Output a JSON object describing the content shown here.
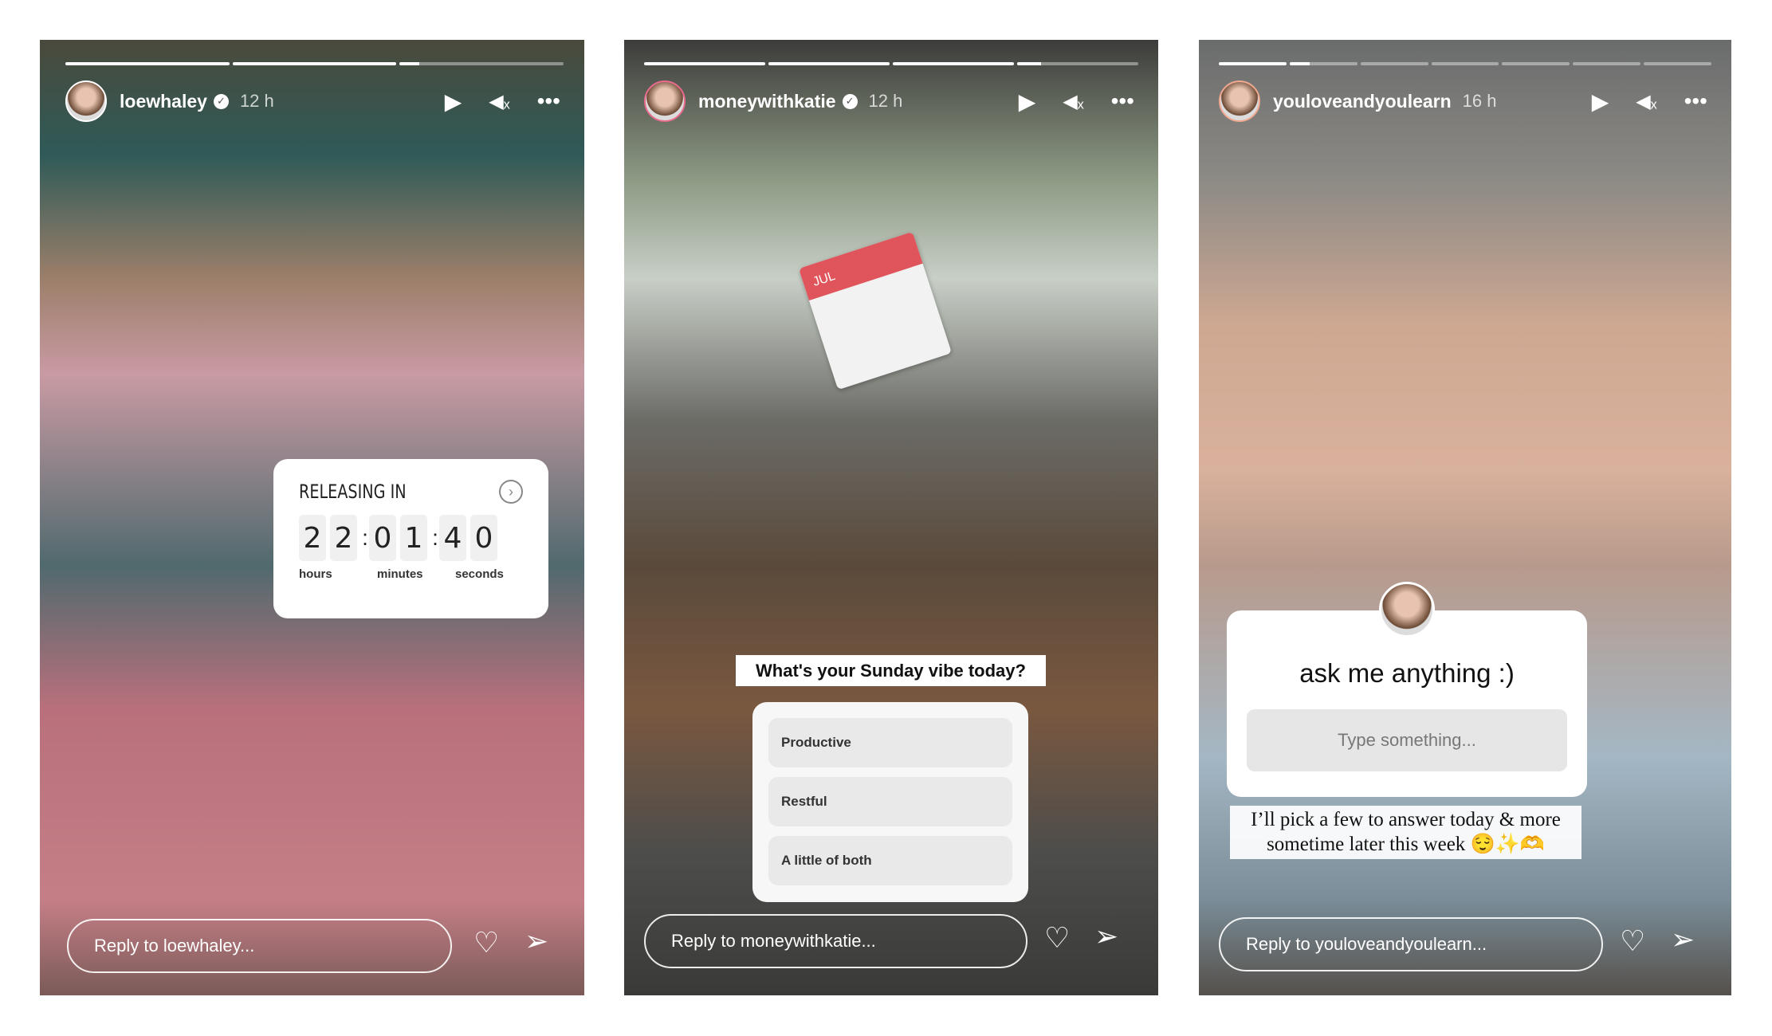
{
  "stories": [
    {
      "username": "loewhaley",
      "verified": true,
      "time": "12 h",
      "progress": [
        1,
        1,
        0.12
      ],
      "reply_placeholder": "Reply to loewhaley...",
      "countdown": {
        "title": "RELEASING IN",
        "digits": [
          "2",
          "2",
          "0",
          "1",
          "4",
          "0"
        ],
        "labels": [
          "hours",
          "minutes",
          "seconds"
        ]
      }
    },
    {
      "username": "moneywithkatie",
      "verified": true,
      "time": "12 h",
      "progress": [
        1,
        1,
        1,
        0.2
      ],
      "reply_placeholder": "Reply to moneywithkatie...",
      "poll": {
        "question": "What's your Sunday vibe today?",
        "options": [
          "Productive",
          "Restful",
          "A little of both"
        ]
      },
      "calendar_month": "JUL"
    },
    {
      "username": "youloveandyoulearn",
      "verified": false,
      "time": "16 h",
      "progress": [
        1,
        0.3,
        0,
        0,
        0,
        0,
        0
      ],
      "reply_placeholder": "Reply to youloveandyoulearn...",
      "question": {
        "prompt": "ask me anything :)",
        "placeholder": "Type something..."
      },
      "caption": "I’ll pick a few to answer today & more sometime later this week 😌✨🫶"
    }
  ],
  "icons": {
    "play": "▶",
    "mute": "🔇",
    "more": "•••",
    "heart": "♡",
    "send": "send-icon"
  }
}
